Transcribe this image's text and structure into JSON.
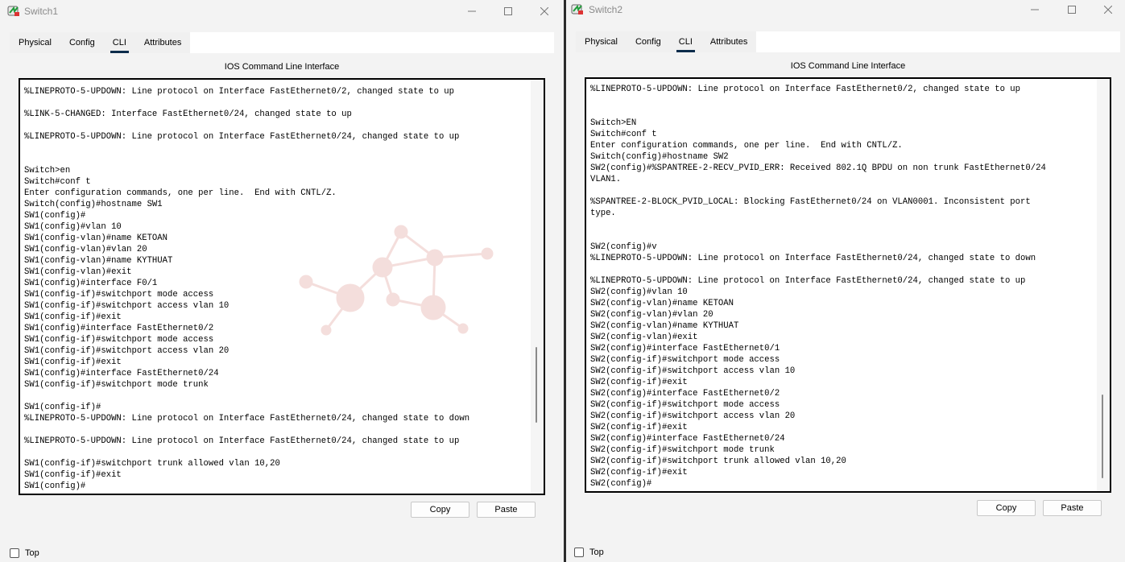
{
  "win1": {
    "title": "Switch1",
    "tabs": [
      "Physical",
      "Config",
      "CLI",
      "Attributes"
    ],
    "active_tab": "CLI",
    "cli_heading": "IOS Command Line Interface",
    "terminal": "%LINEPROTO-5-UPDOWN: Line protocol on Interface FastEthernet0/2, changed state to up\n\n%LINK-5-CHANGED: Interface FastEthernet0/24, changed state to up\n\n%LINEPROTO-5-UPDOWN: Line protocol on Interface FastEthernet0/24, changed state to up\n\n\nSwitch>en\nSwitch#conf t\nEnter configuration commands, one per line.  End with CNTL/Z.\nSwitch(config)#hostname SW1\nSW1(config)#\nSW1(config)#vlan 10\nSW1(config-vlan)#name KETOAN\nSW1(config-vlan)#vlan 20\nSW1(config-vlan)#name KYTHUAT\nSW1(config-vlan)#exit\nSW1(config)#interface F0/1\nSW1(config-if)#switchport mode access\nSW1(config-if)#switchport access vlan 10\nSW1(config-if)#exit\nSW1(config)#interface FastEthernet0/2\nSW1(config-if)#switchport mode access\nSW1(config-if)#switchport access vlan 20\nSW1(config-if)#exit\nSW1(config)#interface FastEthernet0/24\nSW1(config-if)#switchport mode trunk\n\nSW1(config-if)#\n%LINEPROTO-5-UPDOWN: Line protocol on Interface FastEthernet0/24, changed state to down\n\n%LINEPROTO-5-UPDOWN: Line protocol on Interface FastEthernet0/24, changed state to up\n\nSW1(config-if)#switchport trunk allowed vlan 10,20\nSW1(config-if)#exit\nSW1(config)#",
    "scroll_position": 0.86,
    "copy_label": "Copy",
    "paste_label": "Paste",
    "top_label": "Top"
  },
  "win2": {
    "title": "Switch2",
    "tabs": [
      "Physical",
      "Config",
      "CLI",
      "Attributes"
    ],
    "active_tab": "CLI",
    "cli_heading": "IOS Command Line Interface",
    "terminal": "%LINEPROTO-5-UPDOWN: Line protocol on Interface FastEthernet0/2, changed state to up\n\n\nSwitch>EN\nSwitch#conf t\nEnter configuration commands, one per line.  End with CNTL/Z.\nSwitch(config)#hostname SW2\nSW2(config)#%SPANTREE-2-RECV_PVID_ERR: Received 802.1Q BPDU on non trunk FastEthernet0/24\nVLAN1.\n\n%SPANTREE-2-BLOCK_PVID_LOCAL: Blocking FastEthernet0/24 on VLAN0001. Inconsistent port\ntype.\n\n\nSW2(config)#v\n%LINEPROTO-5-UPDOWN: Line protocol on Interface FastEthernet0/24, changed state to down\n\n%LINEPROTO-5-UPDOWN: Line protocol on Interface FastEthernet0/24, changed state to up\nSW2(config)#vlan 10\nSW2(config-vlan)#name KETOAN\nSW2(config-vlan)#vlan 20\nSW2(config-vlan)#name KYTHUAT\nSW2(config-vlan)#exit\nSW2(config)#interface FastEthernet0/1\nSW2(config-if)#switchport mode access\nSW2(config-if)#switchport access vlan 10\nSW2(config-if)#exit\nSW2(config)#interface FastEthernet0/2\nSW2(config-if)#switchport mode access\nSW2(config-if)#switchport access vlan 20\nSW2(config-if)#exit\nSW2(config)#interface FastEthernet0/24\nSW2(config-if)#switchport mode trunk\nSW2(config-if)#switchport trunk allowed vlan 10,20\nSW2(config-if)#exit\nSW2(config)#",
    "scroll_position": 0.87,
    "copy_label": "Copy",
    "paste_label": "Paste",
    "top_label": "Top"
  },
  "icons": {
    "app": "packet-tracer-icon",
    "minimize": "minimize-icon",
    "maximize": "maximize-icon",
    "close": "close-icon"
  },
  "colors": {
    "active_tab_underline": "#0c2c4b",
    "window_bg": "#f3f3f3"
  }
}
